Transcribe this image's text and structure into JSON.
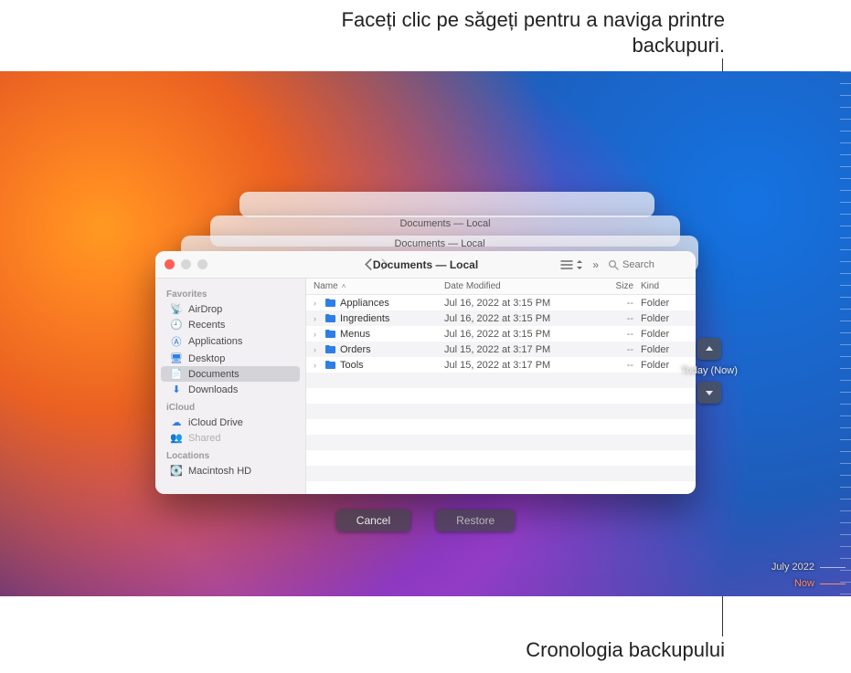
{
  "callouts": {
    "top": "Faceți clic pe săgeți pentru a naviga printre backupuri.",
    "bottom": "Cronologia backupului"
  },
  "ghost_title": "Documents — Local",
  "finder": {
    "title": "Documents — Local",
    "search_placeholder": "Search",
    "columns": {
      "name": "Name",
      "date": "Date Modified",
      "size": "Size",
      "kind": "Kind"
    },
    "sidebar": {
      "groups": [
        {
          "title": "Favorites",
          "items": [
            {
              "key": "airdrop",
              "label": "AirDrop",
              "icon": "📡"
            },
            {
              "key": "recents",
              "label": "Recents",
              "icon": "🕘"
            },
            {
              "key": "applications",
              "label": "Applications",
              "icon": "Ⓐ"
            },
            {
              "key": "desktop",
              "label": "Desktop",
              "icon": "🖥"
            },
            {
              "key": "documents",
              "label": "Documents",
              "icon": "📄",
              "selected": true
            },
            {
              "key": "downloads",
              "label": "Downloads",
              "icon": "⬇"
            }
          ]
        },
        {
          "title": "iCloud",
          "items": [
            {
              "key": "iclouddrive",
              "label": "iCloud Drive",
              "icon": "☁"
            },
            {
              "key": "shared",
              "label": "Shared",
              "icon": "👥",
              "dim": true
            }
          ]
        },
        {
          "title": "Locations",
          "items": [
            {
              "key": "macintoshhd",
              "label": "Macintosh HD",
              "icon": "💽"
            }
          ]
        }
      ]
    },
    "rows": [
      {
        "name": "Appliances",
        "date": "Jul 16, 2022 at 3:15 PM",
        "size": "--",
        "kind": "Folder"
      },
      {
        "name": "Ingredients",
        "date": "Jul 16, 2022 at 3:15 PM",
        "size": "--",
        "kind": "Folder"
      },
      {
        "name": "Menus",
        "date": "Jul 16, 2022 at 3:15 PM",
        "size": "--",
        "kind": "Folder"
      },
      {
        "name": "Orders",
        "date": "Jul 15, 2022 at 3:17 PM",
        "size": "--",
        "kind": "Folder"
      },
      {
        "name": "Tools",
        "date": "Jul 15, 2022 at 3:17 PM",
        "size": "--",
        "kind": "Folder"
      }
    ]
  },
  "tm_nav": {
    "label": "Today (Now)"
  },
  "actions": {
    "cancel": "Cancel",
    "restore": "Restore"
  },
  "timeline_mini": {
    "month": "July 2022",
    "now": "Now"
  }
}
